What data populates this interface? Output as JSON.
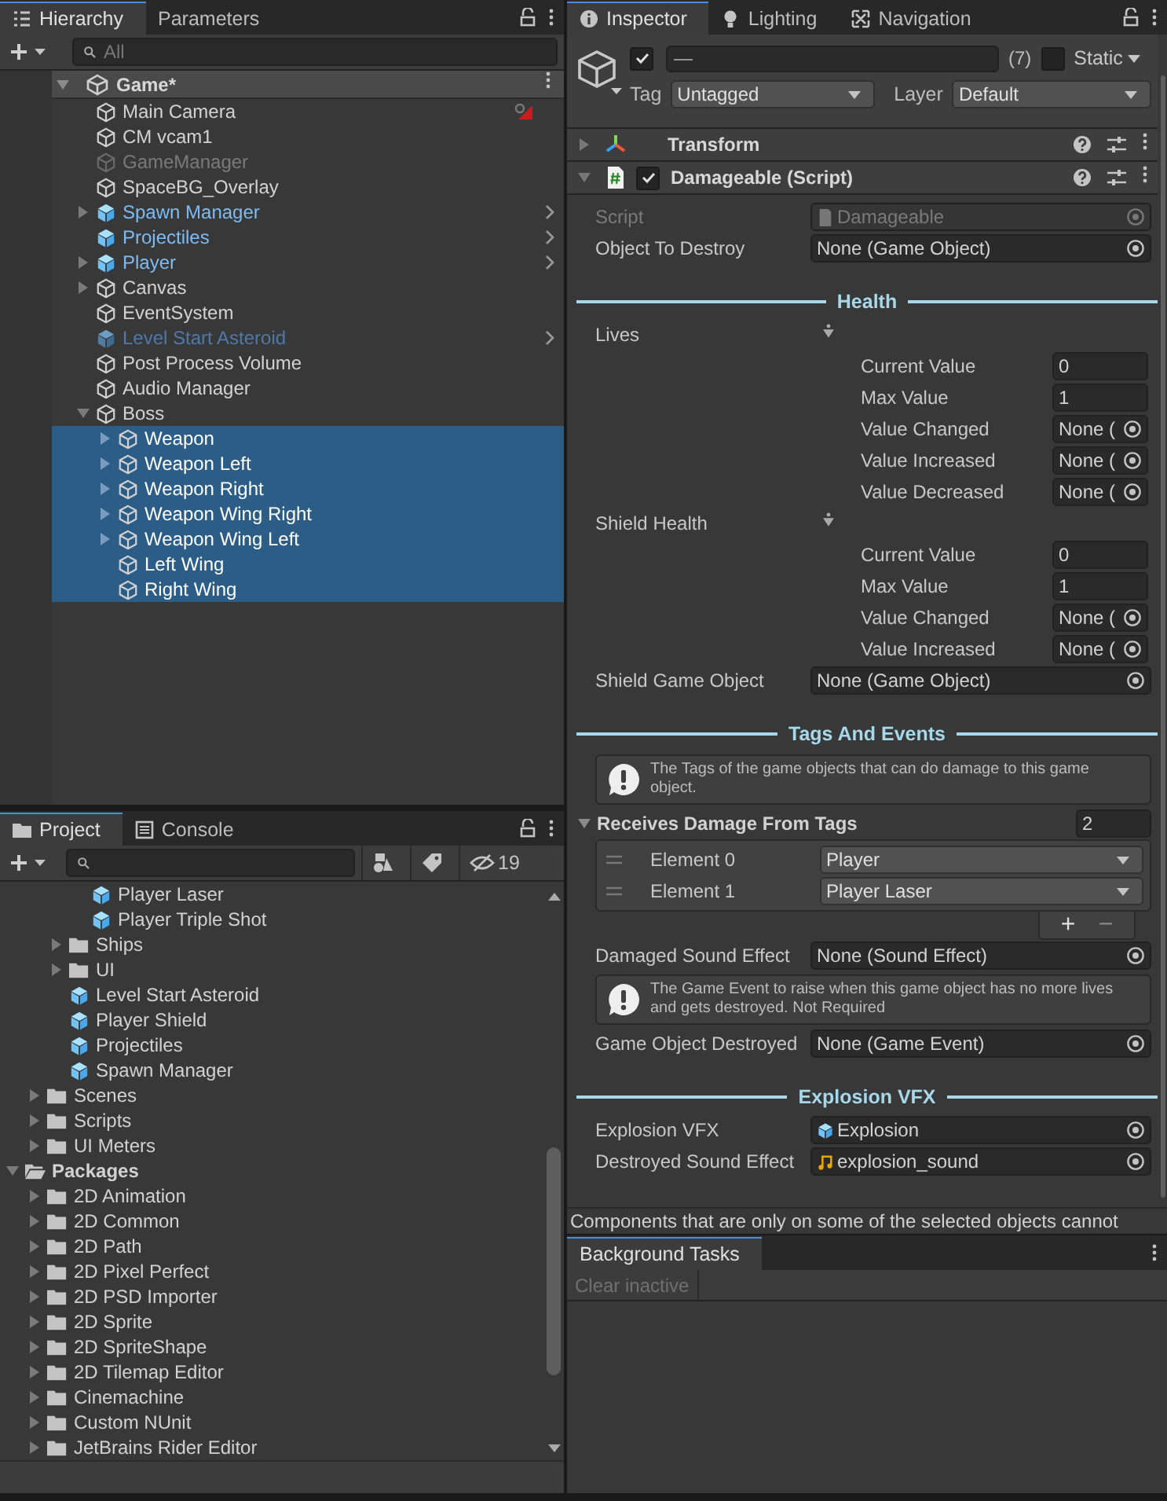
{
  "hierarchy": {
    "tabs": [
      {
        "label": "Hierarchy",
        "selected": true
      },
      {
        "label": "Parameters",
        "selected": false
      }
    ],
    "search": {
      "placeholder": "All"
    },
    "scene": {
      "name": "Game*",
      "expanded": true
    },
    "items": [
      {
        "name": "Main Camera",
        "kind": "object",
        "gizmo": true,
        "selected": false
      },
      {
        "name": "CM vcam1",
        "kind": "object",
        "selected": false
      },
      {
        "name": "GameManager",
        "kind": "object",
        "disabled": true,
        "selected": false
      },
      {
        "name": "SpaceBG_Overlay",
        "kind": "object",
        "selected": false
      },
      {
        "name": "Spawn Manager",
        "kind": "prefab",
        "expanded": false,
        "selected": false
      },
      {
        "name": "Projectiles",
        "kind": "prefab",
        "selected": false
      },
      {
        "name": "Player",
        "kind": "prefab",
        "expanded": false,
        "selected": false
      },
      {
        "name": "Canvas",
        "kind": "object",
        "expanded": false,
        "selected": false
      },
      {
        "name": "EventSystem",
        "kind": "object",
        "selected": false
      },
      {
        "name": "Level Start Asteroid",
        "kind": "prefab",
        "disabled": true,
        "selected": false
      },
      {
        "name": "Post Process Volume",
        "kind": "object",
        "selected": false
      },
      {
        "name": "Audio Manager",
        "kind": "object",
        "selected": false
      },
      {
        "name": "Boss",
        "kind": "object",
        "expanded": true,
        "selected": false,
        "children": [
          {
            "name": "Weapon",
            "kind": "object",
            "expanded": false,
            "selected": true
          },
          {
            "name": "Weapon Left",
            "kind": "object",
            "expanded": false,
            "selected": true
          },
          {
            "name": "Weapon Right",
            "kind": "object",
            "expanded": false,
            "selected": true
          },
          {
            "name": "Weapon Wing Right",
            "kind": "object",
            "expanded": false,
            "selected": true
          },
          {
            "name": "Weapon Wing Left",
            "kind": "object",
            "expanded": false,
            "selected": true
          },
          {
            "name": "Left Wing",
            "kind": "object",
            "selected": true
          },
          {
            "name": "Right Wing",
            "kind": "object",
            "selected": true
          }
        ]
      }
    ]
  },
  "project": {
    "tabs": [
      {
        "label": "Project",
        "selected": true
      },
      {
        "label": "Console",
        "selected": false
      }
    ],
    "hidden_count": "19",
    "items": [
      {
        "children": [
          {
            "children": [
              {
                "children": [
                  {
                    "name": "Player Laser",
                    "kind": "prefab"
                  },
                  {
                    "name": "Player Triple Shot",
                    "kind": "prefab"
                  }
                ]
              },
              {
                "name": "Ships",
                "kind": "folder",
                "expanded": false
              },
              {
                "name": "UI",
                "kind": "folder",
                "expanded": false
              },
              {
                "name": "Level Start Asteroid",
                "kind": "prefab"
              },
              {
                "name": "Player Shield",
                "kind": "prefab"
              },
              {
                "name": "Projectiles",
                "kind": "prefab"
              },
              {
                "name": "Spawn Manager",
                "kind": "prefab"
              }
            ]
          },
          {
            "name": "Scenes",
            "kind": "folder",
            "expanded": false
          },
          {
            "name": "Scripts",
            "kind": "folder",
            "expanded": false
          },
          {
            "name": "UI Meters",
            "kind": "folder",
            "expanded": false
          }
        ]
      },
      {
        "name": "Packages",
        "kind": "folder",
        "expanded": true,
        "children": [
          {
            "name": "2D Animation",
            "kind": "folder",
            "expanded": false
          },
          {
            "name": "2D Common",
            "kind": "folder",
            "expanded": false
          },
          {
            "name": "2D Path",
            "kind": "folder",
            "expanded": false
          },
          {
            "name": "2D Pixel Perfect",
            "kind": "folder",
            "expanded": false
          },
          {
            "name": "2D PSD Importer",
            "kind": "folder",
            "expanded": false
          },
          {
            "name": "2D Sprite",
            "kind": "folder",
            "expanded": false
          },
          {
            "name": "2D SpriteShape",
            "kind": "folder",
            "expanded": false
          },
          {
            "name": "2D Tilemap Editor",
            "kind": "folder",
            "expanded": false
          },
          {
            "name": "Cinemachine",
            "kind": "folder",
            "expanded": false
          },
          {
            "name": "Custom NUnit",
            "kind": "folder",
            "expanded": false
          },
          {
            "name": "JetBrains Rider Editor",
            "kind": "folder",
            "expanded": false
          }
        ]
      }
    ]
  },
  "inspector": {
    "tabs": [
      {
        "label": "Inspector",
        "selected": true
      },
      {
        "label": "Lighting",
        "selected": false
      },
      {
        "label": "Navigation",
        "selected": false
      }
    ],
    "object": {
      "active": true,
      "name": "—",
      "count": "(7)",
      "static": false,
      "static_label": "Static",
      "tag_label": "Tag",
      "tag": "Untagged",
      "layer_label": "Layer",
      "layer": "Default"
    },
    "components": [
      {
        "name": "Transform",
        "kind": "transform",
        "expanded": false
      },
      {
        "name": "Damageable (Script)",
        "kind": "script",
        "expanded": true,
        "enabled": true
      }
    ],
    "fields": [
      {
        "kind": "script_field",
        "label": "Script",
        "value": "Damageable",
        "disabled": true
      },
      {
        "kind": "field",
        "label": "Object To Destroy",
        "value": "None (Game Object)"
      },
      {
        "kind": "header",
        "text": "Health"
      },
      {
        "kind": "group",
        "label": "Lives",
        "rows": [
          {
            "kind": "number",
            "label": "Current Value",
            "value": "0"
          },
          {
            "kind": "number",
            "label": "Max Value",
            "value": "1"
          },
          {
            "kind": "object",
            "label": "Value Changed",
            "value": "None ("
          },
          {
            "kind": "object",
            "label": "Value Increased",
            "value": "None ("
          },
          {
            "kind": "object",
            "label": "Value Decreased",
            "value": "None ("
          }
        ]
      },
      {
        "kind": "group",
        "label": "Shield Health",
        "rows": [
          {
            "kind": "number",
            "label": "Current Value",
            "value": "0"
          },
          {
            "kind": "number",
            "label": "Max Value",
            "value": "1"
          },
          {
            "kind": "object",
            "label": "Value Changed",
            "value": "None ("
          },
          {
            "kind": "object",
            "label": "Value Increased",
            "value": "None ("
          }
        ]
      },
      {
        "kind": "field",
        "label": "Shield Game Object",
        "value": "None (Game Object)"
      },
      {
        "kind": "header",
        "text": "Tags And Events"
      },
      {
        "kind": "help",
        "text": "The Tags of the game objects that can do damage to this game object."
      },
      {
        "kind": "list",
        "label": "Receives Damage From Tags",
        "count": "2",
        "expanded": true,
        "add": "+",
        "remove": "−",
        "elements": [
          {
            "label": "Element 0",
            "value": "Player"
          },
          {
            "label": "Element 1",
            "value": "Player Laser"
          }
        ]
      },
      {
        "kind": "field",
        "label": "Damaged Sound Effect",
        "value": "None (Sound Effect)"
      },
      {
        "kind": "help",
        "text": "The Game Event to raise when this game object has no more lives and gets destroyed. Not Required"
      },
      {
        "kind": "field",
        "label": "Game Object Destroyed",
        "value": "None (Game Event)"
      },
      {
        "kind": "header",
        "text": "Explosion VFX"
      },
      {
        "kind": "prefab_field",
        "label": "Explosion VFX",
        "value": "Explosion"
      },
      {
        "kind": "audio_field",
        "label": "Destroyed Sound Effect",
        "value": "explosion_sound"
      }
    ],
    "note": "Components that are only on some of the selected objects cannot"
  },
  "background_tasks": {
    "tabs": [
      {
        "label": "Background Tasks",
        "selected": true
      }
    ],
    "button": {
      "label": "Clear inactive",
      "disabled": true
    }
  }
}
